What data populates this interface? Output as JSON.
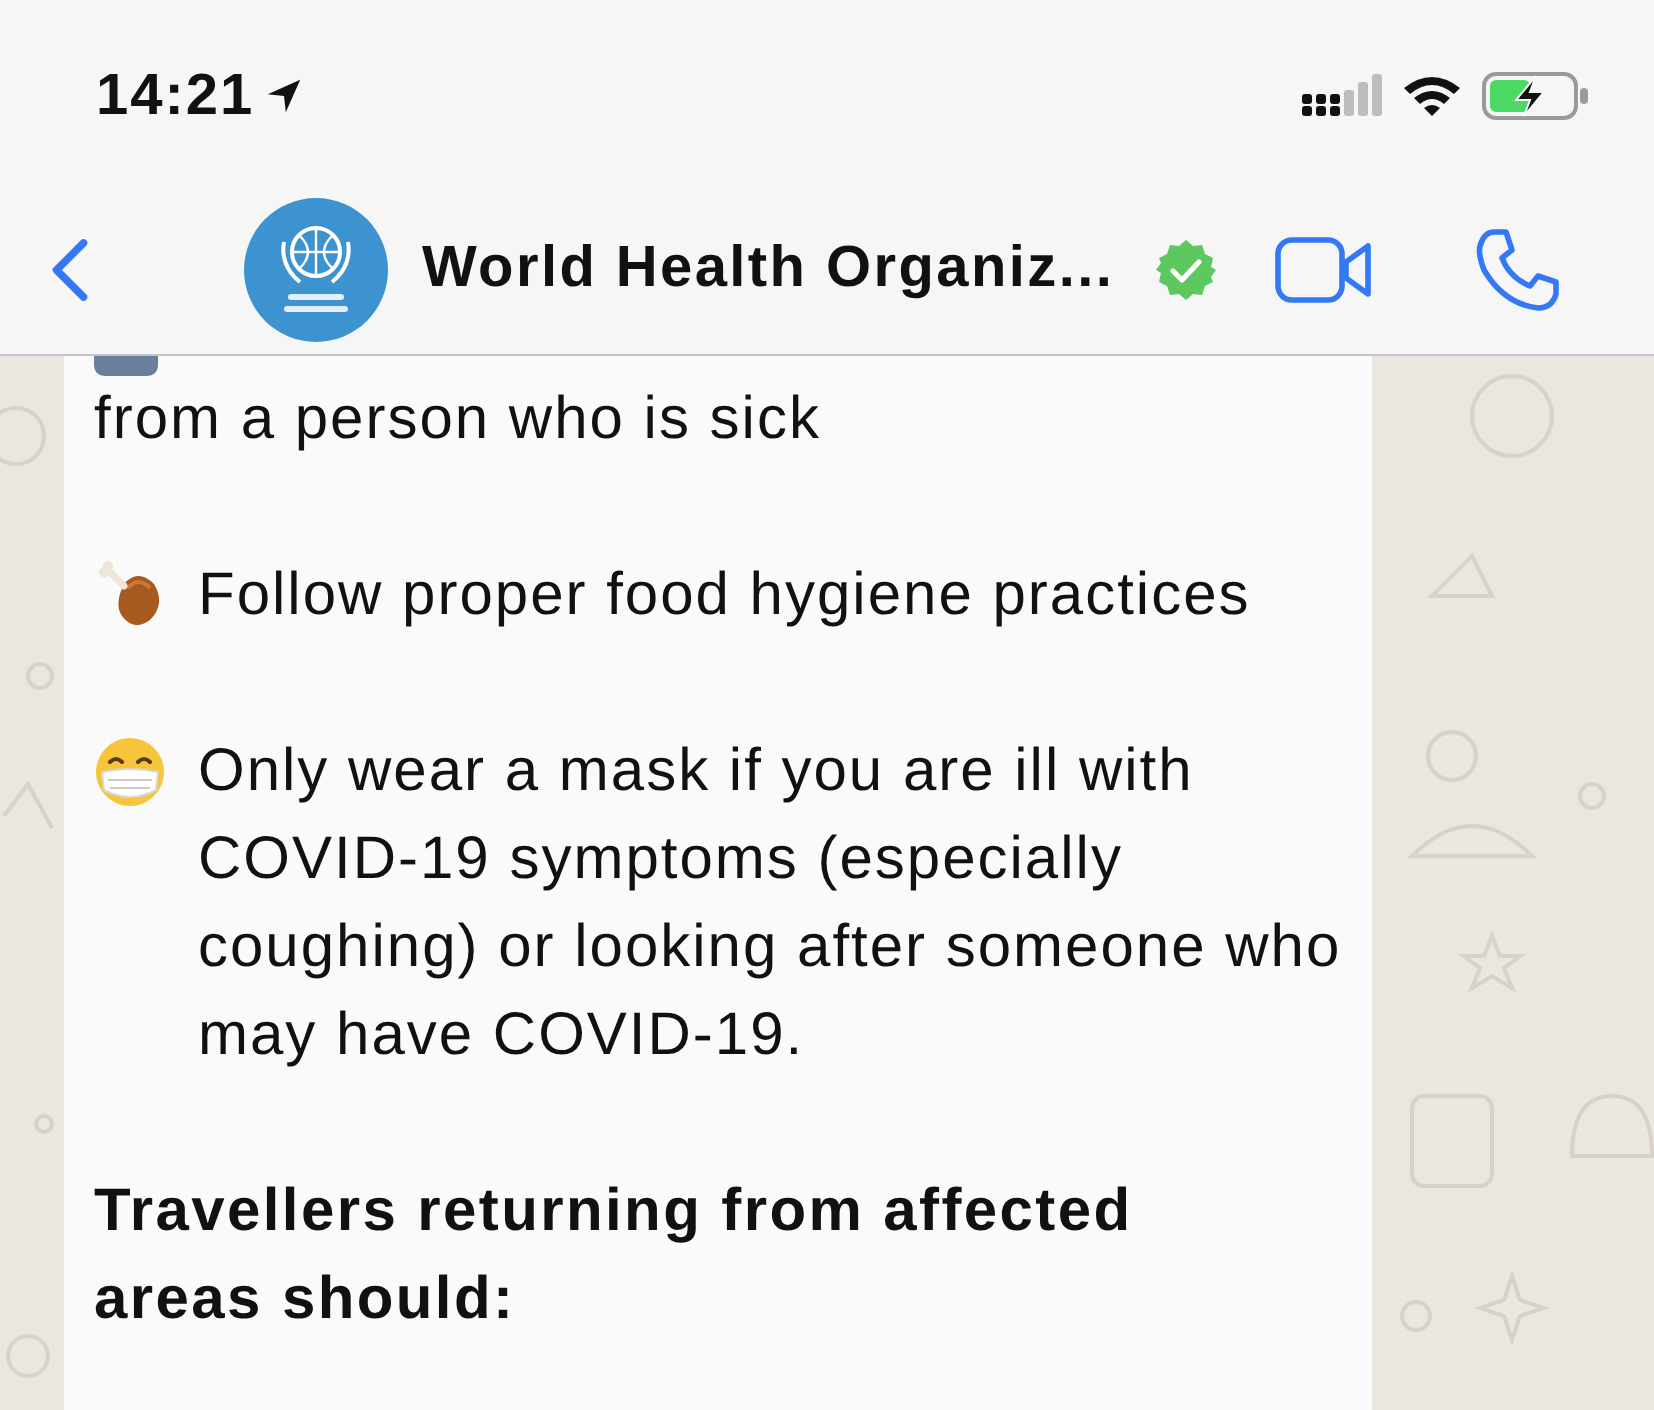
{
  "status_bar": {
    "time": "14:21"
  },
  "header": {
    "title": "World Health Organiz...",
    "verified": true
  },
  "message": {
    "paragraphs": [
      {
        "kind": "plain",
        "text": "from a person who is sick"
      },
      {
        "kind": "emoji",
        "text": "Follow proper food hygiene practices"
      },
      {
        "kind": "emoji",
        "text": "Only wear a mask if you are ill with COVID-19 symptoms (especially coughing) or looking after someone who may have COVID-19."
      },
      {
        "kind": "heading",
        "text": "Travellers returning from affected areas should:"
      }
    ]
  }
}
